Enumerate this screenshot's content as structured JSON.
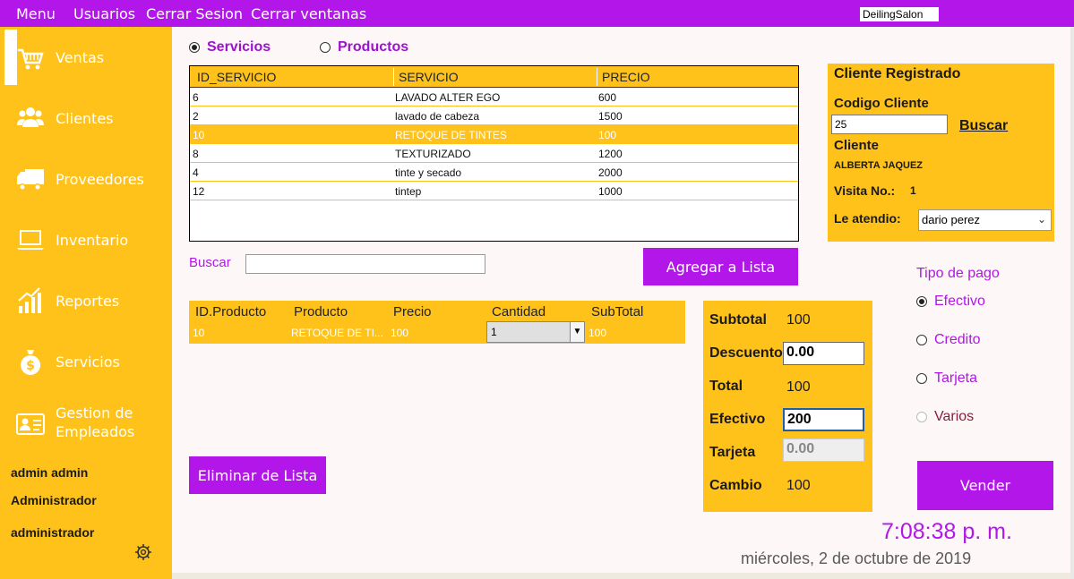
{
  "topbar": {
    "items": [
      "Menu",
      "Usuarios",
      "Cerrar Sesion",
      "Cerrar ventanas"
    ],
    "app_name": "DeilingSalon"
  },
  "sidebar": {
    "items": [
      {
        "label": "Ventas",
        "icon": "cart-icon"
      },
      {
        "label": "Clientes",
        "icon": "users-icon"
      },
      {
        "label": "Proveedores",
        "icon": "truck-icon"
      },
      {
        "label": "Inventario",
        "icon": "laptop-icon"
      },
      {
        "label": "Reportes",
        "icon": "chart-icon"
      },
      {
        "label": "Servicios",
        "icon": "money-bag-icon"
      },
      {
        "label": "Gestion de Empleados",
        "icon": "id-card-icon"
      }
    ],
    "user_name": "admin admin",
    "user_role": "Administrador",
    "user_login": "administrador",
    "settings_icon": "gear-icon"
  },
  "mode": {
    "servicios": "Servicios",
    "productos": "Productos",
    "selected": "Servicios"
  },
  "services_table": {
    "columns": [
      "ID_SERVICIO",
      "SERVICIO",
      "PRECIO"
    ],
    "rows": [
      {
        "id": "6",
        "name": "LAVADO ALTER EGO",
        "price": "600"
      },
      {
        "id": "2",
        "name": "lavado de cabeza",
        "price": "1500"
      },
      {
        "id": "10",
        "name": "RETOQUE DE TINTES",
        "price": "100"
      },
      {
        "id": "8",
        "name": "TEXTURIZADO",
        "price": "1200"
      },
      {
        "id": "4",
        "name": "tinte y secado",
        "price": "2000"
      },
      {
        "id": "12",
        "name": "tintep",
        "price": "1000"
      }
    ],
    "selected_row": 2
  },
  "search": {
    "label": "Buscar",
    "value": ""
  },
  "add_button": "Agregar a Lista",
  "client": {
    "title": "Cliente Registrado",
    "code_label": "Codigo Cliente",
    "code_value": "25",
    "search_link": "Buscar",
    "name_label": "Cliente",
    "name_value": "ALBERTA JAQUEZ",
    "visit_label": "Visita No.:",
    "visit_value": "1",
    "attended_label": "Le atendio:",
    "attended_value": "dario perez"
  },
  "list_table": {
    "columns": [
      "ID.Producto",
      "Producto",
      "Precio",
      "Cantidad",
      "SubTotal"
    ],
    "rows": [
      {
        "id": "10",
        "product": "RETOQUE DE TI...",
        "price": "100",
        "qty": "1",
        "subtotal": "100"
      }
    ]
  },
  "remove_button": "Eliminar de Lista",
  "totals": {
    "subtotal_label": "Subtotal",
    "subtotal_value": "100",
    "discount_label": "Descuento",
    "discount_value": "0.00",
    "total_label": "Total",
    "total_value": "100",
    "cash_label": "Efectivo",
    "cash_value": "200",
    "card_label": "Tarjeta",
    "card_value": "0.00",
    "change_label": "Cambio",
    "change_value": "100"
  },
  "payment": {
    "title": "Tipo de pago",
    "options": [
      "Efectivo",
      "Credito",
      "Tarjeta",
      "Varios"
    ],
    "selected": "Efectivo"
  },
  "sell_button": "Vender",
  "clock": {
    "time": "7:08:38 p. m.",
    "date": "miércoles, 2 de octubre de 2019"
  },
  "colors": {
    "accent": "#b216e8",
    "panel": "#ffc21a",
    "background": "#fdf7f7"
  }
}
